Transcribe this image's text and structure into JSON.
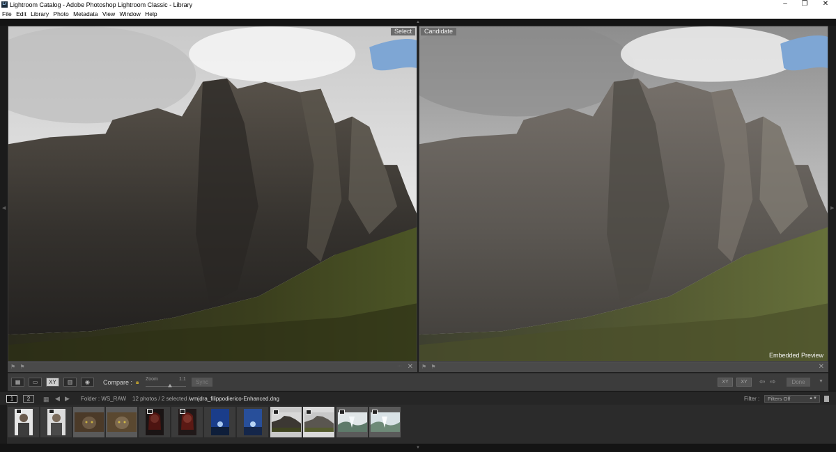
{
  "window": {
    "app_icon_label": "Lr",
    "title": "Lightroom Catalog - Adobe Photoshop Lightroom Classic - Library",
    "minimize": "–",
    "restore": "❐",
    "close": "✕"
  },
  "menu": {
    "items": [
      "File",
      "Edit",
      "Library",
      "Photo",
      "Metadata",
      "View",
      "Window",
      "Help"
    ]
  },
  "compare": {
    "select_tag": "Select",
    "candidate_tag": "Candidate",
    "embedded_preview": "Embedded Preview"
  },
  "toolbar": {
    "view_buttons": [
      "grid-view",
      "loupe-view",
      "compare-view",
      "survey-view",
      "people-view"
    ],
    "xy_label": "XY",
    "compare_label": "Compare :",
    "zoom_label": "Zoom",
    "zoom_ratio": "1:1",
    "sync_label": "Sync",
    "swap_label": "XY",
    "make_select_label": "XY",
    "done_label": "Done",
    "zoom_value": 0.55
  },
  "filmstrip_bar": {
    "monitor_1": "1",
    "monitor_2": "2",
    "folder": "Folder : WS_RAW",
    "count": "12 photos / 2 selected /",
    "filename": "wmjdra_filippodierico-Enhanced.dng",
    "filter_label": "Filter :",
    "filter_value": "Filters Off"
  },
  "filmstrip": {
    "thumbnails": [
      {
        "name": "portrait-man-1",
        "selected": false
      },
      {
        "name": "portrait-man-2",
        "selected": false
      },
      {
        "name": "cat-1",
        "selected": false
      },
      {
        "name": "cat-2",
        "selected": false
      },
      {
        "name": "woman-red-1",
        "selected": false
      },
      {
        "name": "woman-red-2",
        "selected": false
      },
      {
        "name": "blue-sky-1",
        "selected": false
      },
      {
        "name": "blue-sky-2",
        "selected": false
      },
      {
        "name": "mountain-1",
        "selected": true
      },
      {
        "name": "mountain-2",
        "selected": true
      },
      {
        "name": "waterfall-1",
        "selected": false
      },
      {
        "name": "waterfall-2",
        "selected": false
      }
    ]
  },
  "colors": {
    "background": "#1f1f1f",
    "panel": "#3c3c3c",
    "selected_cell": "#c9c9c9",
    "tag": "#6b6b6b"
  }
}
